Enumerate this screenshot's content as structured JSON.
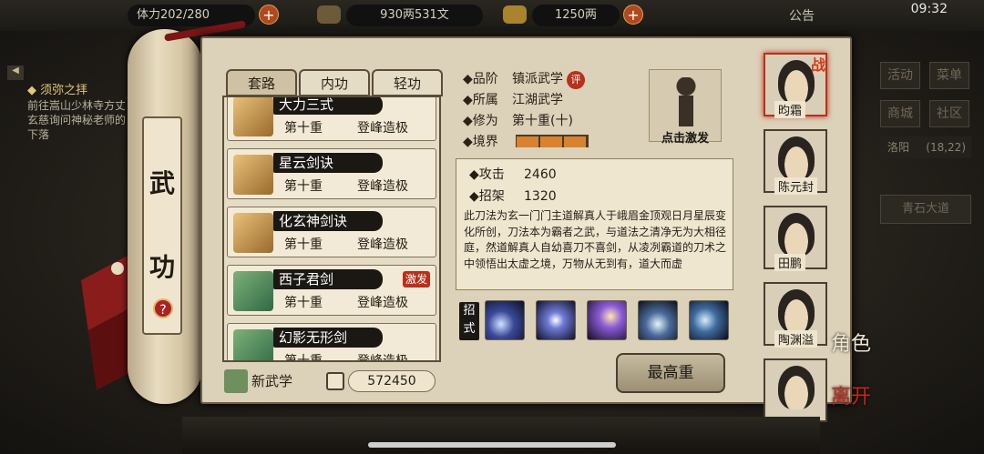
{
  "topbar": {
    "stamina": "体力202/280",
    "silver": "930两531文",
    "gold": "1250两",
    "notice": "公告",
    "clock": "09:32",
    "plus": "+"
  },
  "task": {
    "title": "◆ 须弥之拝",
    "desc": "前往嵩山少林寺方丈玄慈询问神秘老师的下落"
  },
  "scroll": {
    "char1": "武",
    "char2": "功",
    "help": "?"
  },
  "tabs": [
    "套路",
    "内功",
    "轻功"
  ],
  "skills": [
    {
      "name": "大力三式",
      "level": "第十重",
      "status": "登峰造极",
      "tag": ""
    },
    {
      "name": "星云剑诀",
      "level": "第十重",
      "status": "登峰造极",
      "tag": ""
    },
    {
      "name": "化玄神剑诀",
      "level": "第十重",
      "status": "登峰造极",
      "tag": ""
    },
    {
      "name": "西子君剑",
      "level": "第十重",
      "status": "登峰造极",
      "tag": "激发"
    },
    {
      "name": "幻影无形剑",
      "level": "第十重",
      "status": "登峰造极",
      "tag": ""
    }
  ],
  "new_skill": "新武学",
  "points": "572450",
  "detail": {
    "rank_label": "◆品阶",
    "rank": "镇派武学",
    "review": "评",
    "belong_label": "◆所属",
    "belong": "江湖武学",
    "cult_label": "◆修为",
    "cult": "第十重(十)",
    "realm_label": "◆境界",
    "realm_fill": 1.0,
    "activate": "点击激发",
    "attack_label": "◆攻击",
    "attack": "2460",
    "parry_label": "◆招架",
    "parry": "1320",
    "description": "此刀法为玄一门门主道解真人于峨眉金顶观日月星辰变化所创，刀法本为霸者之武，与道法之清净无为大相径庭，然道解真人自幼喜刀不喜剑，从凌冽霸道的刀术之中领悟出太虚之境，万物从无到有，道大而虚"
  },
  "moves_label": "招式",
  "moves": [
    "move-1",
    "move-2",
    "move-3",
    "move-4",
    "move-5"
  ],
  "max_button": "最高重",
  "characters": [
    {
      "name": "昀霜",
      "selected": true
    },
    {
      "name": "陈元封",
      "selected": false
    },
    {
      "name": "田鹏",
      "selected": false
    },
    {
      "name": "陶渊溢",
      "selected": false
    },
    {
      "name": "",
      "selected": false
    }
  ],
  "battle_badge": "战",
  "right_menu": {
    "activity": "活动",
    "menu": "菜单",
    "shop": "商城",
    "community": "社区",
    "city": "洛阳",
    "coords": "(18,22)",
    "road": "青石大道"
  },
  "side": {
    "role": "角色",
    "leave": "离开"
  }
}
